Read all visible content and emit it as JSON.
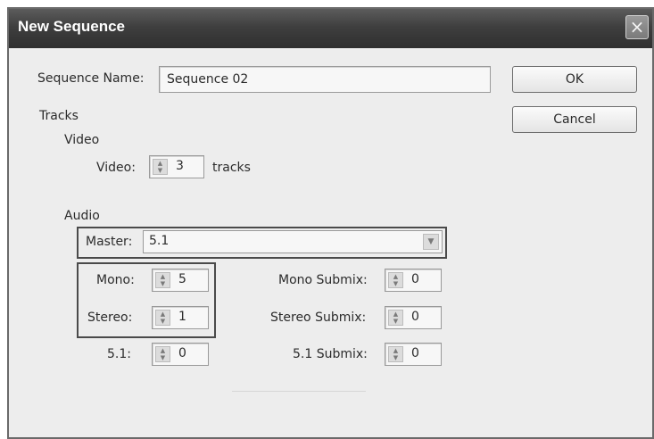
{
  "dialog": {
    "title": "New Sequence",
    "close_glyph": "×"
  },
  "sequence_name": {
    "label": "Sequence Name:",
    "value": "Sequence 02"
  },
  "buttons": {
    "ok": "OK",
    "cancel": "Cancel"
  },
  "tracks": {
    "heading": "Tracks",
    "video": {
      "heading": "Video",
      "label": "Video:",
      "value": "3",
      "unit": "tracks"
    },
    "audio": {
      "heading": "Audio",
      "master_label": "Master:",
      "master_value": "5.1",
      "mono_label": "Mono:",
      "mono_value": "5",
      "stereo_label": "Stereo:",
      "stereo_value": "1",
      "surround_label": "5.1:",
      "surround_value": "0",
      "mono_submix_label": "Mono Submix:",
      "mono_submix_value": "0",
      "stereo_submix_label": "Stereo Submix:",
      "stereo_submix_value": "0",
      "surround_submix_label": "5.1 Submix:",
      "surround_submix_value": "0"
    }
  },
  "icons": {
    "spinner": "spinner-arrows-icon",
    "dropdown": "chevron-down-icon",
    "close": "close-icon"
  }
}
